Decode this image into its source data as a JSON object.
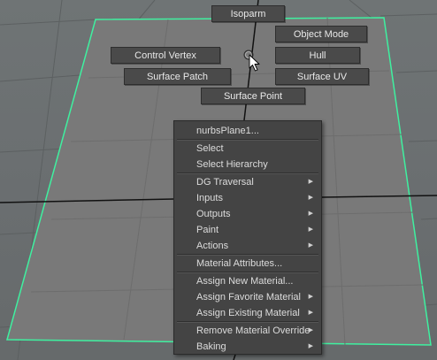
{
  "viewport": {
    "object": "nurbsPlane1",
    "colors": {
      "background": "#6b6f70",
      "grid": "#5c6061",
      "plane_fill": "#797979",
      "selection_outline": "#3ff0a0",
      "axis_line": "#111111"
    }
  },
  "marking_menu": {
    "north": "Isoparm",
    "north_east": "Object Mode",
    "west": "Control Vertex",
    "east": "Hull",
    "south_west": "Surface Patch",
    "south_east": "Surface UV",
    "south": "Surface Point"
  },
  "context_menu": {
    "header": "nurbsPlane1...",
    "select": "Select",
    "select_hierarchy": "Select Hierarchy",
    "dg_traversal": "DG Traversal",
    "inputs": "Inputs",
    "outputs": "Outputs",
    "paint": "Paint",
    "actions": "Actions",
    "material_attributes": "Material Attributes...",
    "assign_new_material": "Assign New Material...",
    "assign_favorite_material": "Assign Favorite Material",
    "assign_existing_material": "Assign Existing Material",
    "remove_material_override": "Remove Material Override",
    "baking": "Baking",
    "submenu_icon": "triangle-right-icon"
  }
}
